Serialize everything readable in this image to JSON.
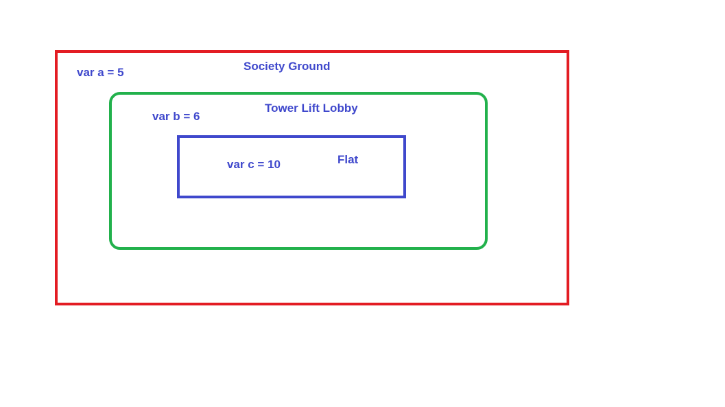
{
  "diagram": {
    "outer": {
      "title": "Society Ground",
      "variable": "var a = 5",
      "border_color": "#e31c23"
    },
    "middle": {
      "title": "Tower Lift Lobby",
      "variable": "var b = 6",
      "border_color": "#22b14c"
    },
    "inner": {
      "title": "Flat",
      "variable": "var c = 10",
      "border_color": "#3f48cc"
    },
    "text_color": "#3f48cc"
  }
}
